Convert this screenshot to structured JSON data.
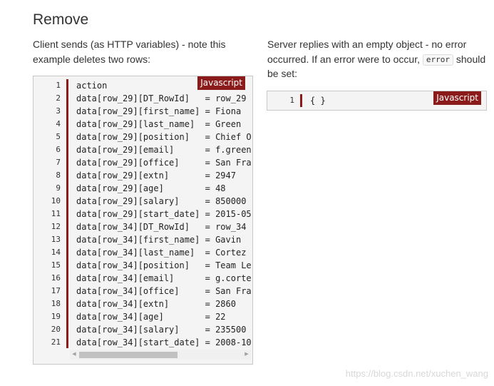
{
  "heading": "Remove",
  "client": {
    "description": "Client sends (as HTTP variables) - note this example deletes two rows:",
    "lang_badge": "Javascript",
    "lines": [
      {
        "n": "1",
        "text": "action"
      },
      {
        "n": "2",
        "text": "data[row_29][DT_RowId]   = row_29"
      },
      {
        "n": "3",
        "text": "data[row_29][first_name] = Fiona"
      },
      {
        "n": "4",
        "text": "data[row_29][last_name]  = Green"
      },
      {
        "n": "5",
        "text": "data[row_29][position]   = Chief O"
      },
      {
        "n": "6",
        "text": "data[row_29][email]      = f.green"
      },
      {
        "n": "7",
        "text": "data[row_29][office]     = San Fra"
      },
      {
        "n": "8",
        "text": "data[row_29][extn]       = 2947"
      },
      {
        "n": "9",
        "text": "data[row_29][age]        = 48"
      },
      {
        "n": "10",
        "text": "data[row_29][salary]     = 850000"
      },
      {
        "n": "11",
        "text": "data[row_29][start_date] = 2015-05"
      },
      {
        "n": "12",
        "text": "data[row_34][DT_RowId]   = row_34"
      },
      {
        "n": "13",
        "text": "data[row_34][first_name] = Gavin"
      },
      {
        "n": "14",
        "text": "data[row_34][last_name]  = Cortez"
      },
      {
        "n": "15",
        "text": "data[row_34][position]   = Team Le"
      },
      {
        "n": "16",
        "text": "data[row_34][email]      = g.corte"
      },
      {
        "n": "17",
        "text": "data[row_34][office]     = San Fra"
      },
      {
        "n": "18",
        "text": "data[row_34][extn]       = 2860"
      },
      {
        "n": "19",
        "text": "data[row_34][age]        = 22"
      },
      {
        "n": "20",
        "text": "data[row_34][salary]     = 235500"
      },
      {
        "n": "21",
        "text": "data[row_34][start_date] = 2008-10"
      }
    ],
    "scroll_left_icon": "triangle-left",
    "scroll_right_icon": "triangle-right"
  },
  "server": {
    "description_before": "Server replies with an empty object - no error occurred. If an error were to occur,",
    "inline_code": "error",
    "description_after": "should be set:",
    "lang_badge": "Javascript",
    "lines": [
      {
        "n": "1",
        "text": "{ }"
      }
    ]
  },
  "watermark": "https://blog.csdn.net/xuchen_wang",
  "colors": {
    "badge_bg": "#8b1a1a",
    "code_bg": "#f4f4f4",
    "text": "#333333"
  }
}
